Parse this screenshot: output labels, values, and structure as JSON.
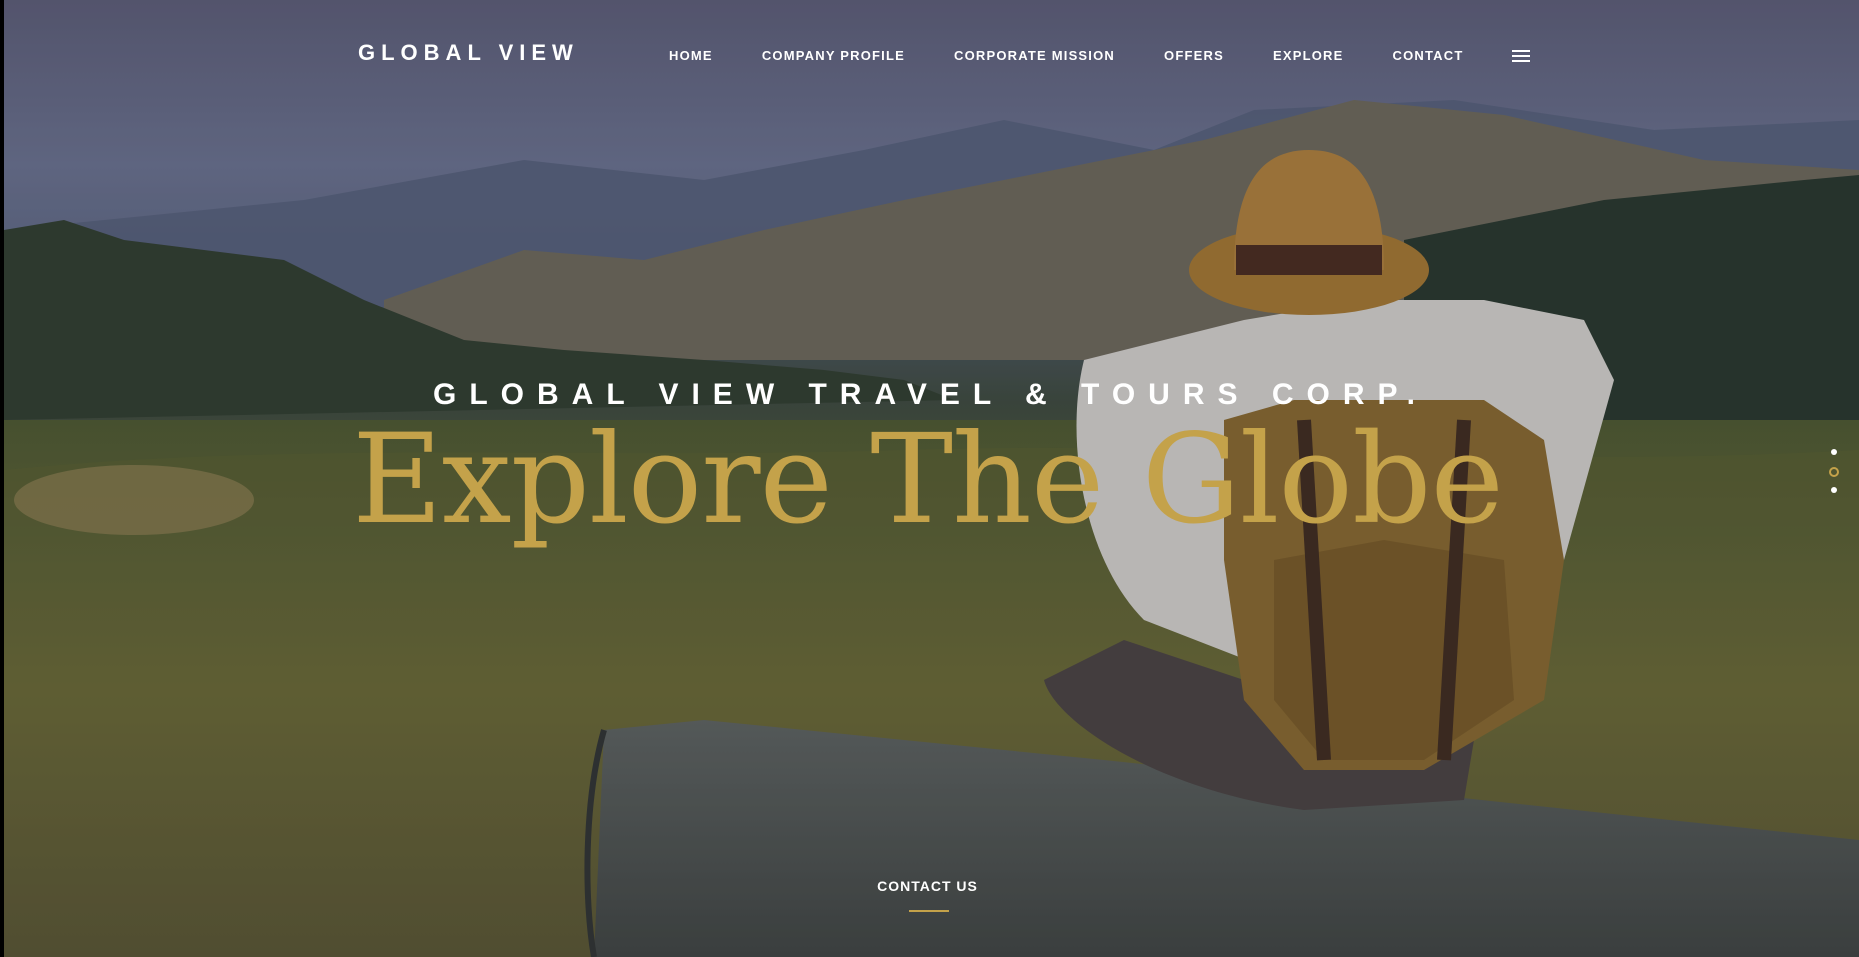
{
  "header": {
    "brand": "GLOBAL VIEW",
    "nav": [
      {
        "label": "HOME"
      },
      {
        "label": "COMPANY PROFILE"
      },
      {
        "label": "CORPORATE MISSION"
      },
      {
        "label": "OFFERS"
      },
      {
        "label": "EXPLORE"
      },
      {
        "label": "CONTACT"
      }
    ],
    "menu_icon": "hamburger-icon"
  },
  "hero": {
    "kicker": "GLOBAL VIEW TRAVEL & TOURS CORP.",
    "headline": "Explore The Globe",
    "slides": {
      "count": 3,
      "active": 2
    },
    "cta_label": "CONTACT US"
  },
  "colors": {
    "accent": "#c4a24a",
    "text": "#ffffff"
  }
}
